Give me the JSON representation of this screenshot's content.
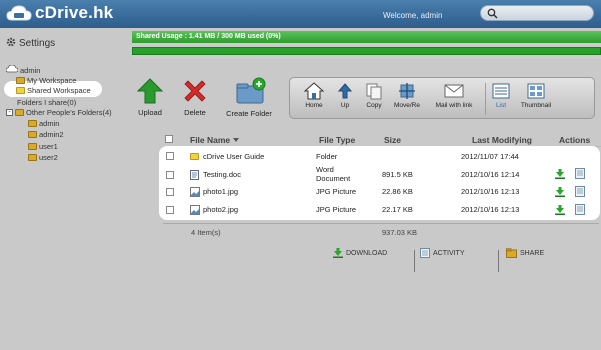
{
  "app": {
    "title": "cDrive.hk",
    "welcome": "Welcome, admin"
  },
  "sidebar": {
    "settings_label": "Settings",
    "tree": [
      {
        "label": "admin",
        "icon": "drive-icon"
      },
      {
        "label": "My Workspace",
        "icon": "folder-icon"
      },
      {
        "label": "Shared Workspace",
        "icon": "folder-icon",
        "selected": true
      },
      {
        "label": "Folders I share(0)",
        "icon": ""
      },
      {
        "label": "Other People's Folders(4)",
        "icon": "folder-icon"
      },
      {
        "label": "admin",
        "icon": "folder-icon"
      },
      {
        "label": "admin2",
        "icon": "folder-icon"
      },
      {
        "label": "user1",
        "icon": "folder-icon"
      },
      {
        "label": "user2",
        "icon": "folder-icon"
      }
    ]
  },
  "usage": {
    "text": "Shared Usage : 1.41 MB / 300 MB used (0%)"
  },
  "toolbar": {
    "upload": "Upload",
    "delete": "Delete",
    "create_folder": "Create Folder",
    "home": "Home",
    "up": "Up",
    "copy": "Copy",
    "move": "Move/Re",
    "mail": "Mail with link",
    "list": "List",
    "thumbnail": "Thumbnail"
  },
  "table": {
    "headers": {
      "name": "File Name",
      "type": "File Type",
      "size": "Size",
      "modified": "Last Modifying",
      "actions": "Actions"
    },
    "rows": [
      {
        "name": "cDrive User Guide",
        "type": "Folder",
        "type2": "",
        "size": "",
        "modified": "2012/11/07 17:44",
        "icon": "folder-icon"
      },
      {
        "name": "Testing.doc",
        "type": "Word",
        "type2": "Document",
        "size": "891.5 KB",
        "modified": "2012/10/16 12:14",
        "icon": "word-document-icon"
      },
      {
        "name": "photo1.jpg",
        "type": "JPG Picture",
        "type2": "",
        "size": "22.86 KB",
        "modified": "2012/10/16 12:13",
        "icon": "image-file-icon"
      },
      {
        "name": "photo2.jpg",
        "type": "JPG Picture",
        "type2": "",
        "size": "22.17 KB",
        "modified": "2012/10/16 12:13",
        "icon": "image-file-icon"
      }
    ],
    "summary": {
      "count": "4 Item(s)",
      "total": "937.03 KB"
    }
  },
  "bottom_actions": {
    "download": "DOWNLOAD",
    "activity": "ACTIVITY",
    "share": "SHARE"
  },
  "colors": {
    "topbar": "#3a6e9d",
    "usage_green": "#27a12a",
    "accent": "#2f6aa5"
  }
}
